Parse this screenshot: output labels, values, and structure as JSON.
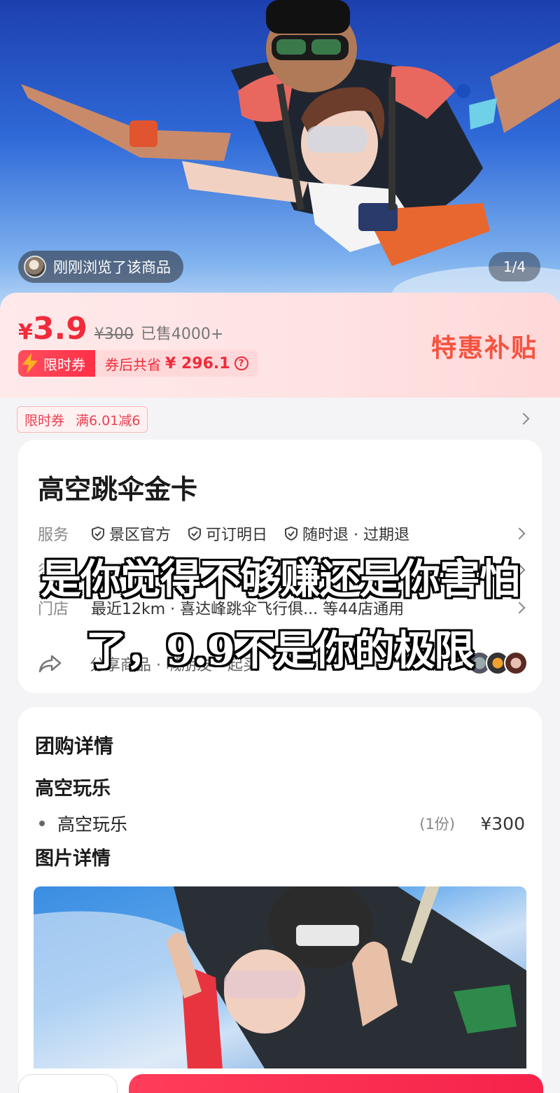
{
  "hero": {
    "recent_view_text": "刚刚浏览了该商品",
    "page_counter": "1/4"
  },
  "price": {
    "currency": "¥",
    "current": "3.9",
    "original": "¥300",
    "sold": "已售4000+",
    "coupon_label": "限时券",
    "coupon_save_prefix": "券后共省",
    "coupon_save_amount": "¥ 296.1",
    "subsidy_label": "特惠补贴"
  },
  "limit_coupon": {
    "label": "限时券",
    "rule": "满6.01减6"
  },
  "product": {
    "title": "高空跳伞金卡",
    "service_label": "服务",
    "services": [
      "景区官方",
      "可订明日",
      "随时退 · 过期退"
    ],
    "notice_label": "须",
    "store_label": "门店",
    "store_text": "最近12km · 喜达峰跳伞飞行俱... 等44店通用",
    "share_text": "分享商品 · 喊朋友一起买"
  },
  "caption": {
    "line1": "是你觉得不够赚还是你害怕",
    "line2": "了，9.9不是你的极限"
  },
  "details": {
    "section_title": "团购详情",
    "group_title": "高空玩乐",
    "item_name": "高空玩乐",
    "item_qty": "(1份)",
    "item_price": "¥300",
    "image_section_title": "图片详情"
  },
  "colors": {
    "accent_red": "#f02b3b",
    "subsidy_orange": "#f5533f"
  }
}
